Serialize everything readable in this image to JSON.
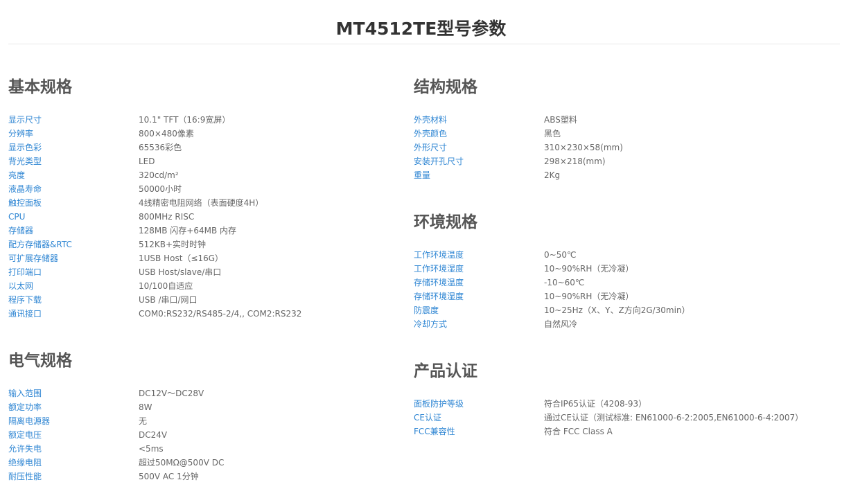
{
  "title": "MT4512TE型号参数",
  "sections": {
    "basic": {
      "heading": "基本规格",
      "rows": [
        {
          "label": "显示尺寸",
          "value": "10.1\" TFT（16:9宽屏）"
        },
        {
          "label": "分辨率",
          "value": "800×480像素"
        },
        {
          "label": "显示色彩",
          "value": "65536彩色"
        },
        {
          "label": "背光类型",
          "value": "LED"
        },
        {
          "label": "亮度",
          "value": "320cd/m²"
        },
        {
          "label": "液晶寿命",
          "value": "50000小时"
        },
        {
          "label": "触控面板",
          "value": "4线精密电阻网络（表面硬度4H）"
        },
        {
          "label": "CPU",
          "value": "800MHz RISC"
        },
        {
          "label": "存储器",
          "value": "128MB  闪存+64MB 内存"
        },
        {
          "label": "配方存储器&RTC",
          "value": "512KB+实时时钟"
        },
        {
          "label": "可扩展存储器",
          "value": "1USB Host（≤16G）"
        },
        {
          "label": "打印端口",
          "value": "USB Host/slave/串口"
        },
        {
          "label": "以太网",
          "value": "10/100自适应"
        },
        {
          "label": "程序下载",
          "value": "USB /串口/网口"
        },
        {
          "label": "通讯接口",
          "value": "COM0:RS232/RS485-2/4,, COM2:RS232"
        }
      ]
    },
    "electrical": {
      "heading": "电气规格",
      "rows": [
        {
          "label": "输入范围",
          "value": "DC12V～DC28V"
        },
        {
          "label": "额定功率",
          "value": "8W"
        },
        {
          "label": "隔离电源器",
          "value": "无"
        },
        {
          "label": "额定电压",
          "value": "DC24V"
        },
        {
          "label": "允许失电",
          "value": "<5ms"
        },
        {
          "label": "绝缘电阻",
          "value": "超过50MΩ@500V DC"
        },
        {
          "label": "耐压性能",
          "value": "500V AC 1分钟"
        }
      ]
    },
    "structure": {
      "heading": "结构规格",
      "rows": [
        {
          "label": "外壳材料",
          "value": "ABS塑料"
        },
        {
          "label": "外壳颜色",
          "value": "黑色"
        },
        {
          "label": "外形尺寸",
          "value": "310×230×58(mm)"
        },
        {
          "label": "安装开孔尺寸",
          "value": "298×218(mm)"
        },
        {
          "label": "重量",
          "value": "2Kg"
        }
      ]
    },
    "environment": {
      "heading": "环境规格",
      "rows": [
        {
          "label": "工作环境温度",
          "value": "0~50℃"
        },
        {
          "label": "工作环境湿度",
          "value": "10~90%RH（无冷凝）"
        },
        {
          "label": "存储环境温度",
          "value": "-10~60℃"
        },
        {
          "label": "存储环境湿度",
          "value": "10~90%RH（无冷凝）"
        },
        {
          "label": "防震度",
          "value": "10~25Hz（X、Y、Z方向2G/30min）"
        },
        {
          "label": "冷却方式",
          "value": "自然风冷"
        }
      ]
    },
    "certification": {
      "heading": "产品认证",
      "rows": [
        {
          "label": "面板防护等级",
          "value": "符合IP65认证（4208-93）"
        },
        {
          "label": "CE认证",
          "value": "通过CE认证（测试标准: EN61000-6-2:2005,EN61000-6-4:2007）"
        },
        {
          "label": "FCC兼容性",
          "value": "符合 FCC Class A"
        }
      ]
    }
  }
}
